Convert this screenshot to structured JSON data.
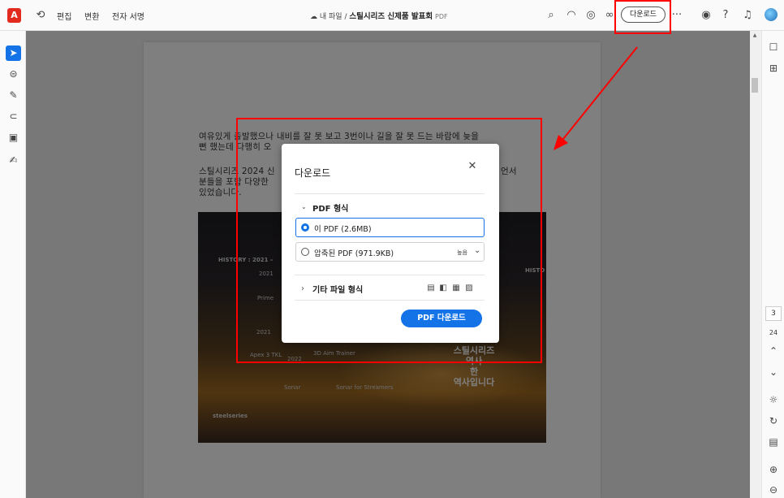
{
  "toolbar": {
    "logo": "A",
    "menu": [
      "편집",
      "변환",
      "전자 서명"
    ],
    "breadcrumb_root": "내 파일",
    "breadcrumb_sep": "/",
    "doc_title": "스틸시리즈 신제품 발표회",
    "doc_type": "PDF",
    "download_label": "다운로드",
    "more": "···"
  },
  "document": {
    "para1": [
      "여유있게 출발했으나 내비를 잘 못 보고 3번이나 길을 잘 못 드는 바람에 늦을",
      "뻔 했는데 다행히 오"
    ],
    "para2": [
      "스틸시리즈 2024 신",
      "언서",
      "분들을 포함 다양한",
      "있었습니다."
    ],
    "photo_texts": {
      "history": "HISTORY : 2021 –",
      "history_right": "HISTO",
      "y2021": "2021",
      "prime": "Prime",
      "y2021b": "2021",
      "apex": "Apex 3 TKL",
      "y2022": "2022",
      "aim": "3D Aim Trainer",
      "sonar": "Sonar",
      "sonar_streamers": "Sonar for Streamers",
      "steelseries": "steelseries",
      "big_line1": "스틸시리즈",
      "big_line2": "역사",
      "big_line3": "한",
      "big_line4": "역사입니다"
    }
  },
  "dialog": {
    "title": "다운로드",
    "section_pdf": "PDF 형식",
    "option_this_pdf": "이 PDF (2.6MB)",
    "option_compressed": "압축된 PDF (971.9KB)",
    "compress_level": "높음",
    "section_other": "기타 파일 형식",
    "primary_button": "PDF 다운로드"
  },
  "rightrail": {
    "current_page": "3",
    "total_pages": "24"
  },
  "colors": {
    "accent": "#1473e6",
    "annotation": "#ff0000",
    "logo": "#e22b1e"
  }
}
